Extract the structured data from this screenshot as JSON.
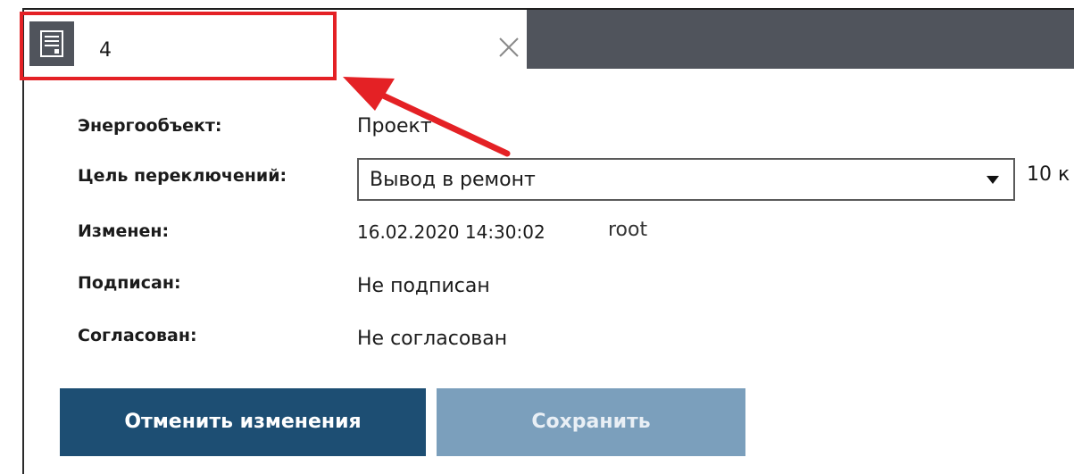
{
  "tab": {
    "value": "4",
    "icon": "document-icon",
    "close_icon": "close-icon"
  },
  "fields": {
    "energy_object": {
      "label": "Энергообъект:",
      "value": "Проект"
    },
    "switch_goal": {
      "label": "Цель переключений:",
      "selected": "Вывод в ремонт",
      "extra": "10 к"
    },
    "modified": {
      "label": "Изменен:",
      "date": "16.02.2020 14:30:02",
      "user": "root"
    },
    "signed": {
      "label": "Подписан:",
      "value": "Не подписан"
    },
    "agreed": {
      "label": "Согласован:",
      "value": "Не согласован"
    }
  },
  "buttons": {
    "cancel": "Отменить изменения",
    "save": "Сохранить"
  },
  "colors": {
    "tabbar": "#50545c",
    "primary": "#1d4e73",
    "disabled": "#7b9fbc",
    "annotation": "#e42125"
  }
}
